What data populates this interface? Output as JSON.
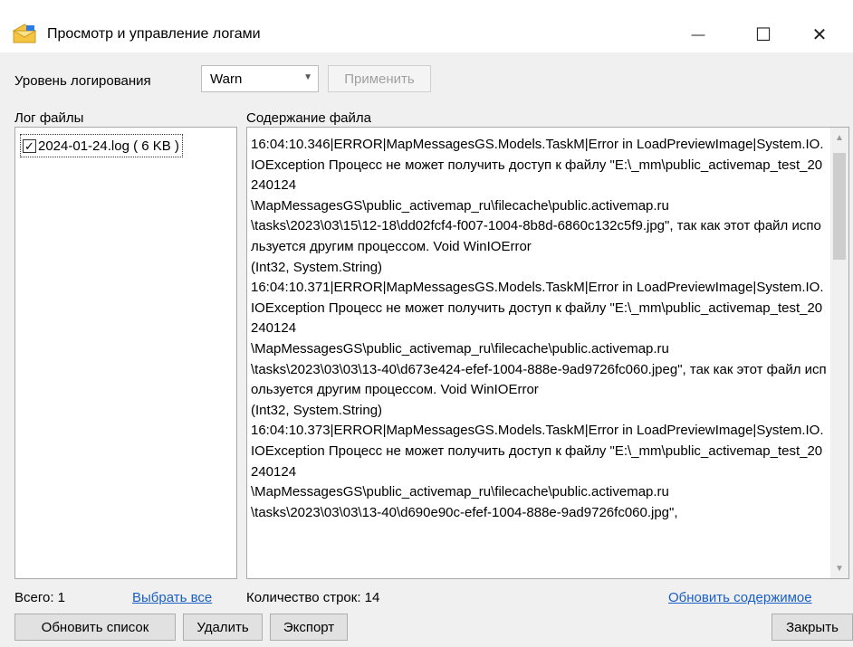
{
  "window": {
    "title": "Просмотр и управление логами",
    "controls": {
      "minimize": "—",
      "maximize": "☐",
      "close": "✕"
    }
  },
  "toolbar": {
    "log_level_label": "Уровень логирования",
    "log_level_value": "Warn",
    "apply_label": "Применить"
  },
  "files_panel": {
    "label": "Лог файлы",
    "items": [
      {
        "checked": true,
        "check_glyph": "✓",
        "name": "2024-01-24.log ( 6 KB )"
      }
    ]
  },
  "content_panel": {
    "label": "Содержание файла",
    "text": "16:04:10.346|ERROR|MapMessagesGS.Models.TaskM|Error in LoadPreviewImage|System.IO.IOException Процесс не может получить доступ к файлу \"E:\\_mm\\public_activemap_test_20240124\n\\MapMessagesGS\\public_activemap_ru\\filecache\\public.activemap.ru\n\\tasks\\2023\\03\\15\\12-18\\dd02fcf4-f007-1004-8b8d-6860c132c5f9.jpg\", так как этот файл используется другим процессом. Void WinIOError\n(Int32, System.String)\n16:04:10.371|ERROR|MapMessagesGS.Models.TaskM|Error in LoadPreviewImage|System.IO.IOException Процесс не может получить доступ к файлу \"E:\\_mm\\public_activemap_test_20240124\n\\MapMessagesGS\\public_activemap_ru\\filecache\\public.activemap.ru\n\\tasks\\2023\\03\\03\\13-40\\d673e424-efef-1004-888e-9ad9726fc060.jpeg\", так как этот файл используется другим процессом. Void WinIOError\n(Int32, System.String)\n16:04:10.373|ERROR|MapMessagesGS.Models.TaskM|Error in LoadPreviewImage|System.IO.IOException Процесс не может получить доступ к файлу \"E:\\_mm\\public_activemap_test_20240124\n\\MapMessagesGS\\public_activemap_ru\\filecache\\public.activemap.ru\n\\tasks\\2023\\03\\03\\13-40\\d690e90c-efef-1004-888e-9ad9726fc060.jpg\","
  },
  "footer": {
    "total_label": "Всего: 1",
    "select_all_link": "Выбрать все",
    "line_count_label": "Количество строк: 14",
    "refresh_content_link": "Обновить содержимое"
  },
  "buttons": {
    "refresh_list": "Обновить список",
    "delete": "Удалить",
    "export": "Экспорт",
    "close": "Закрыть"
  },
  "icons": {
    "app": "envelope-icon",
    "dropdown": "chevron-down-icon",
    "scroll_up": "scroll-up-arrow-icon",
    "scroll_down": "scroll-down-arrow-icon"
  },
  "colors": {
    "link": "#1a5fc4",
    "app_icon_envelope": "#f5c542",
    "app_icon_accent": "#2d7be5"
  }
}
